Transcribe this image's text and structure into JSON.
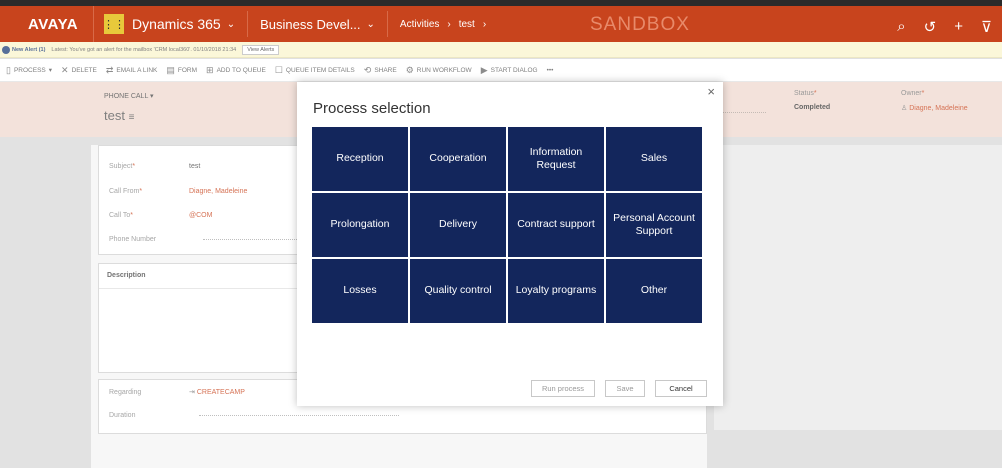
{
  "nav": {
    "logo": "AVAYA",
    "grid_icon": "app-grid-icon",
    "app_name": "Dynamics 365",
    "app_chevron": "⌄",
    "area": "Business Devel...",
    "area_chevron": "⌄",
    "breadcrumb_1": "Activities",
    "breadcrumb_sep1": "›",
    "breadcrumb_2": "test",
    "breadcrumb_sep2": "›",
    "sandbox": "SANDBOX",
    "icons": [
      "search-icon",
      "history-icon",
      "plus-icon",
      "filter-icon"
    ]
  },
  "alert": {
    "title": "New Alert (1)",
    "text": "Latest: You've got an alert for the mailbox 'CRM local360'. 01/10/2018 21:34",
    "button": "View Alerts"
  },
  "commands": [
    {
      "icon": "▯",
      "label": "PROCESS",
      "chev": "▾"
    },
    {
      "icon": "✕",
      "label": "DELETE",
      "chev": ""
    },
    {
      "icon": "⇄",
      "label": "EMAIL A LINK",
      "chev": ""
    },
    {
      "icon": "▤",
      "label": "FORM",
      "chev": ""
    },
    {
      "icon": "⊞",
      "label": "ADD TO QUEUE",
      "chev": ""
    },
    {
      "icon": "☐",
      "label": "QUEUE ITEM DETAILS",
      "chev": ""
    },
    {
      "icon": "⟲",
      "label": "SHARE",
      "chev": ""
    },
    {
      "icon": "⚙",
      "label": "RUN WORKFLOW",
      "chev": ""
    },
    {
      "icon": "▶",
      "label": "START DIALOG",
      "chev": ""
    },
    {
      "icon": "",
      "label": "•••",
      "chev": ""
    }
  ],
  "header": {
    "entity": "PHONE CALL",
    "entity_chevron": "▾",
    "record_name": "test",
    "record_icon": "≡",
    "status_label": "Status",
    "status_value": "Completed",
    "owner_label": "Owner",
    "owner_value": "Diagne, Madeleine",
    "required": "*"
  },
  "form": {
    "subject_label": "Subject",
    "subject_value": "test",
    "call_from_label": "Call From",
    "call_from_value": "Diagne, Madeleine",
    "call_to_label": "Call To",
    "call_to_value": "@COM",
    "phone_label": "Phone Number",
    "description_title": "Description",
    "regarding_label": "Regarding",
    "regarding_value": "CREATECAMP",
    "duration_label": "Duration",
    "required": "*"
  },
  "dialog": {
    "title": "Process selection",
    "close": "×",
    "tiles": [
      "Reception",
      "Cooperation",
      "Information Request",
      "Sales",
      "Prolongation",
      "Delivery",
      "Contract support",
      "Personal Account Support",
      "Losses",
      "Quality control",
      "Loyalty programs",
      "Other"
    ],
    "run_button": "Run process",
    "save_button": "Save",
    "cancel_button": "Cancel"
  }
}
